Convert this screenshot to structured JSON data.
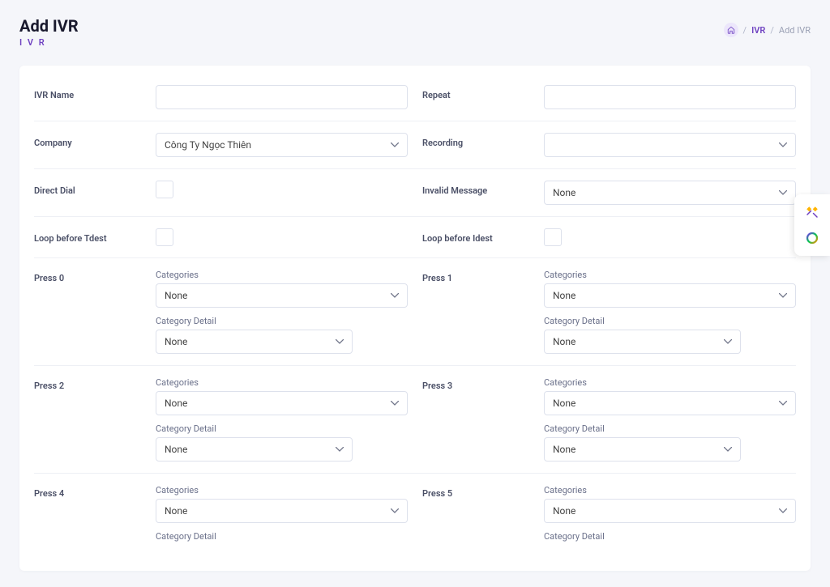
{
  "header": {
    "title": "Add IVR",
    "subtitle": "I V R"
  },
  "breadcrumb": {
    "ivr": "IVR",
    "add": "Add IVR"
  },
  "labels": {
    "ivr_name": "IVR Name",
    "repeat": "Repeat",
    "company": "Company",
    "recording": "Recording",
    "direct_dial": "Direct Dial",
    "invalid_message": "Invalid Message",
    "loop_tdest": "Loop before Tdest",
    "loop_idest": "Loop before Idest",
    "categories": "Categories",
    "category_detail": "Category Detail"
  },
  "values": {
    "company": "Công Ty Ngọc Thiên",
    "invalid_message": "None",
    "none": "None"
  },
  "press": {
    "p0": "Press 0",
    "p1": "Press 1",
    "p2": "Press 2",
    "p3": "Press 3",
    "p4": "Press 4",
    "p5": "Press 5"
  }
}
